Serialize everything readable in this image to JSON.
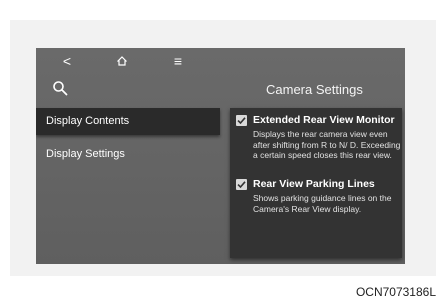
{
  "toolbar": {
    "back_icon": "chevron-left-icon",
    "back_glyph": "<",
    "home_icon": "home-icon",
    "menu_icon": "menu-icon",
    "menu_glyph": "≡"
  },
  "header": {
    "search_icon": "search-icon",
    "title": "Camera Settings"
  },
  "sidebar": {
    "items": [
      {
        "label": "Display Contents",
        "selected": true
      },
      {
        "label": "Display Settings",
        "selected": false
      }
    ]
  },
  "settings": {
    "options": [
      {
        "title": "Extended Rear View Monitor",
        "description": "Displays the rear camera view even after shifting from R to N/ D. Exceeding a certain speed closes this rear view.",
        "checked": true
      },
      {
        "title": "Rear View Parking Lines",
        "description": "Shows parking guidance lines on the Camera's Rear View display.",
        "checked": true
      }
    ]
  },
  "figure": {
    "code": "OCN7073186L"
  },
  "colors": {
    "screen_bg": "#636363",
    "selected_bg": "#2a2a2a",
    "panel_bg": "#333333",
    "checkbox": "#d9d9d9"
  }
}
